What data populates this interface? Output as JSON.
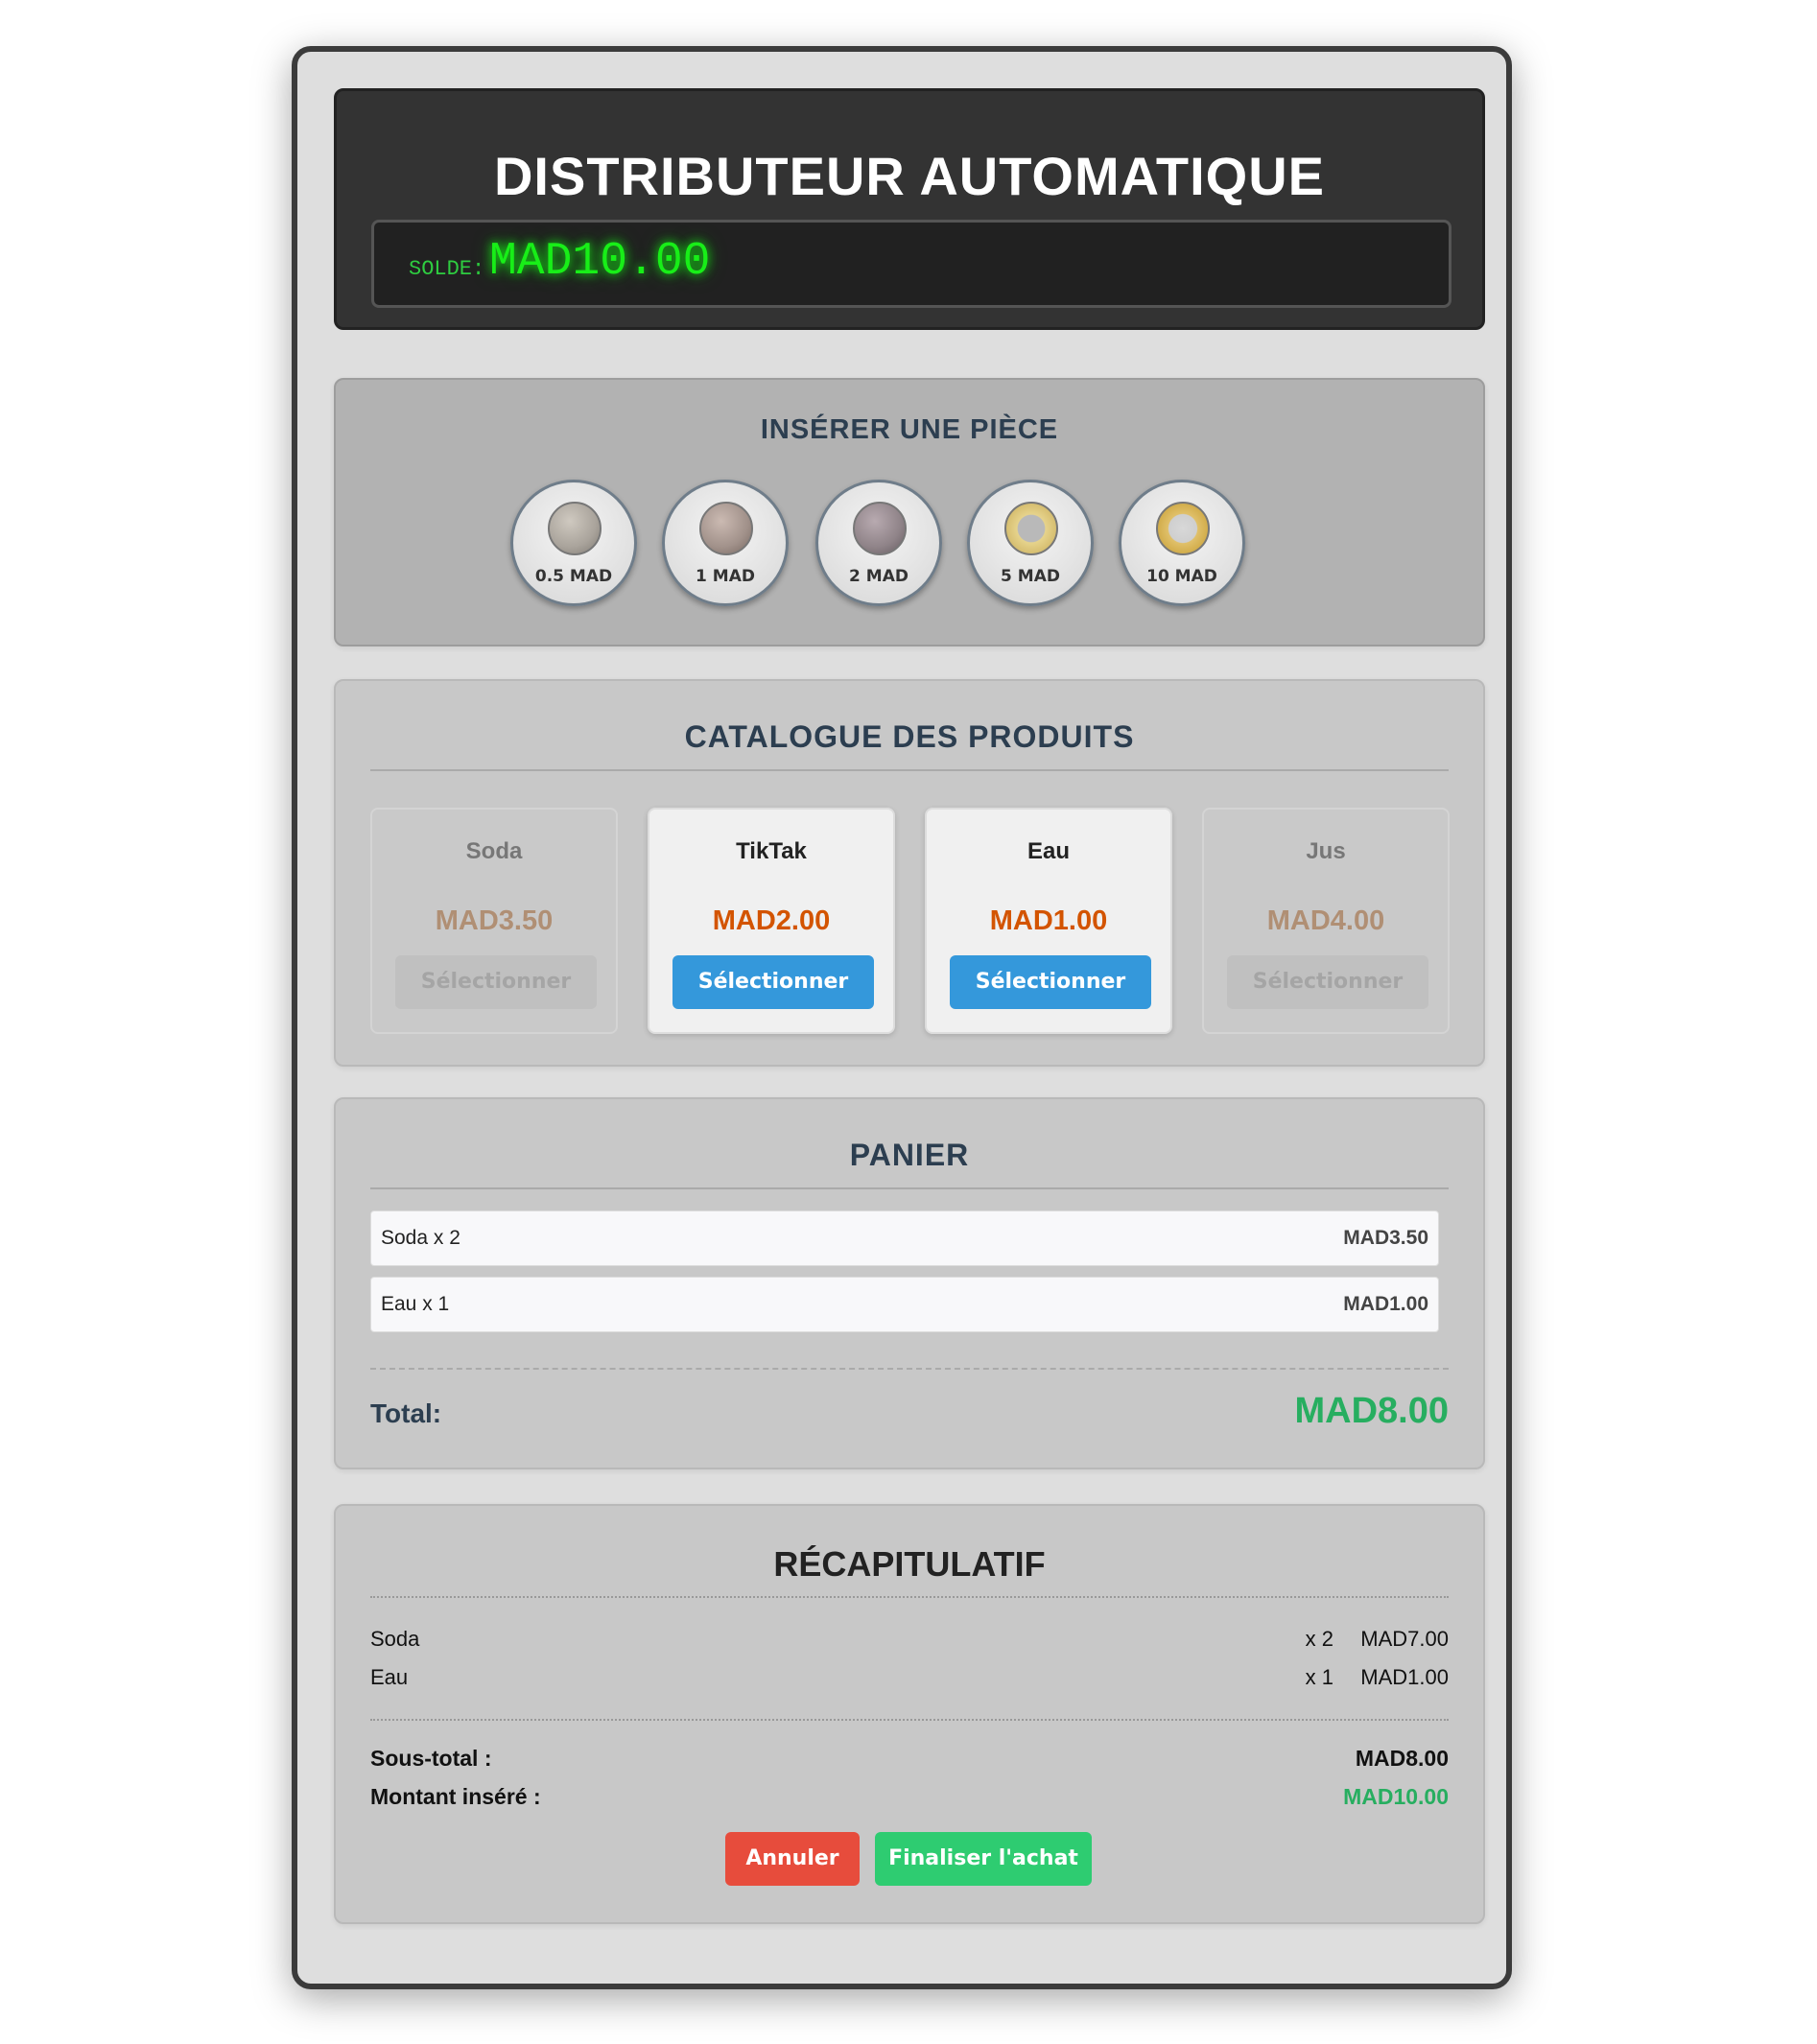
{
  "header": {
    "title": "DISTRIBUTEUR AUTOMATIQUE",
    "balance_label": "SOLDE:",
    "balance_value": "MAD10.00"
  },
  "coins": {
    "title": "INSÉRER UNE PIÈCE",
    "items": [
      {
        "label": "0.5 MAD",
        "icon": "coin-0.5-mad-icon",
        "color": "#a9a39b"
      },
      {
        "label": "1 MAD",
        "icon": "coin-1-mad-icon",
        "color": "#a1918a"
      },
      {
        "label": "2 MAD",
        "icon": "coin-2-mad-icon",
        "color": "#8f8388"
      },
      {
        "label": "5 MAD",
        "icon": "coin-5-mad-icon",
        "color": "#d9c98a"
      },
      {
        "label": "10 MAD",
        "icon": "coin-10-mad-icon",
        "color": "#d4b95a"
      }
    ]
  },
  "catalog": {
    "title": "CATALOGUE DES PRODUITS",
    "products": [
      {
        "name": "Soda",
        "price": "MAD3.50",
        "button": "Sélectionner",
        "enabled": false
      },
      {
        "name": "TikTak",
        "price": "MAD2.00",
        "button": "Sélectionner",
        "enabled": true
      },
      {
        "name": "Eau",
        "price": "MAD1.00",
        "button": "Sélectionner",
        "enabled": true
      },
      {
        "name": "Jus",
        "price": "MAD4.00",
        "button": "Sélectionner",
        "enabled": false
      }
    ]
  },
  "cart": {
    "title": "PANIER",
    "items": [
      {
        "label": "Soda x 2",
        "price": "MAD3.50"
      },
      {
        "label": "Eau x 1",
        "price": "MAD1.00"
      }
    ],
    "total_label": "Total:",
    "total_value": "MAD8.00"
  },
  "recap": {
    "title": "RÉCAPITULATIF",
    "items": [
      {
        "name": "Soda",
        "qty": "x 2",
        "price": "MAD7.00"
      },
      {
        "name": "Eau",
        "qty": "x 1",
        "price": "MAD1.00"
      }
    ],
    "subtotal_label": "Sous-total :",
    "subtotal_value": "MAD8.00",
    "inserted_label": "Montant inséré :",
    "inserted_value": "MAD10.00",
    "cancel_label": "Annuler",
    "confirm_label": "Finaliser l'achat"
  },
  "colors": {
    "accent_blue": "#3498db",
    "price_orange": "#d35400",
    "total_green": "#27ae60",
    "cancel_red": "#e74c3c",
    "confirm_green": "#2ecc71",
    "display_green": "#18ee18"
  }
}
